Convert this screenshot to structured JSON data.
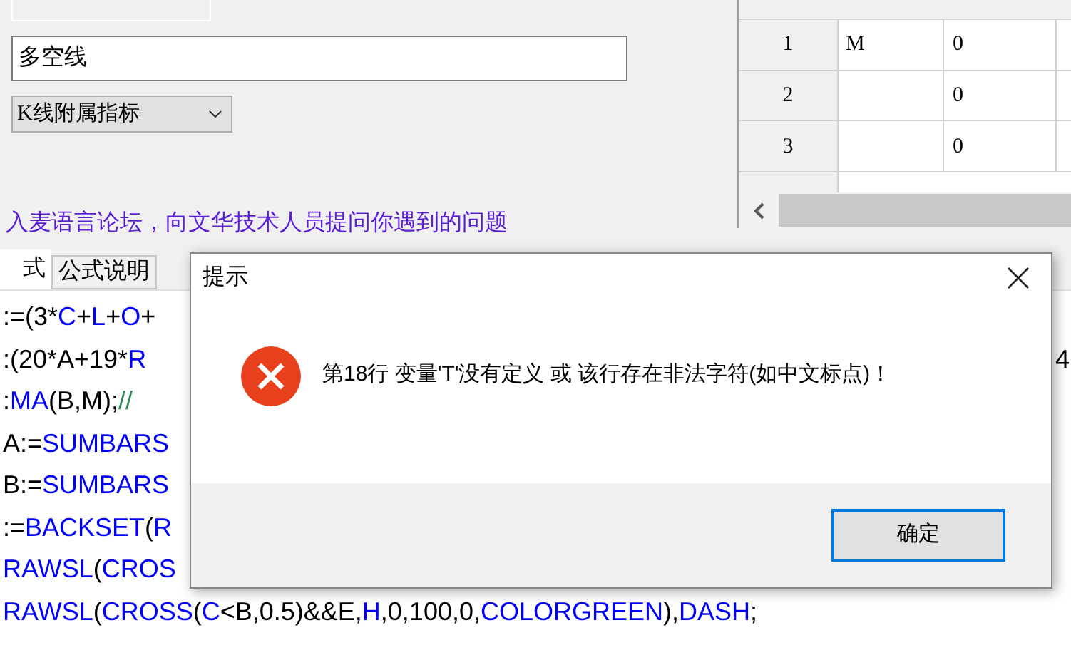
{
  "top_panel": {
    "name_field": {
      "value": "多空线"
    },
    "type_select": {
      "value": "K线附属指标"
    },
    "forum_link": "入麦语言论坛，向文华技术人员提问你遇到的问题"
  },
  "param_table": {
    "rows": [
      {
        "index": "1",
        "column_2": "M",
        "column_3": "0"
      },
      {
        "index": "2",
        "column_2": "",
        "column_3": "0"
      },
      {
        "index": "3",
        "column_2": "",
        "column_3": "0"
      }
    ]
  },
  "tabs": [
    {
      "label": "式",
      "selected": true
    },
    {
      "label": "公式说明",
      "selected": false
    }
  ],
  "editor": {
    "lines": [
      {
        "tokens": [
          {
            "text": ":=(3*",
            "kind": "plain"
          },
          {
            "text": "C",
            "kind": "keyword"
          },
          {
            "text": "+",
            "kind": "plain"
          },
          {
            "text": "L",
            "kind": "keyword"
          },
          {
            "text": "+",
            "kind": "plain"
          },
          {
            "text": "O",
            "kind": "keyword"
          },
          {
            "text": "+",
            "kind": "plain"
          }
        ]
      },
      {
        "tokens": [
          {
            "text": ":(20*A+19*",
            "kind": "plain"
          },
          {
            "text": "R",
            "kind": "keyword"
          }
        ],
        "trailing": "4"
      },
      {
        "tokens": [
          {
            "text": ":",
            "kind": "plain"
          },
          {
            "text": "MA",
            "kind": "keyword"
          },
          {
            "text": "(B,M);",
            "kind": "plain"
          },
          {
            "text": "//",
            "kind": "comment"
          }
        ]
      },
      {
        "tokens": [
          {
            "text": "A:=",
            "kind": "plain"
          },
          {
            "text": "SUMBARS",
            "kind": "keyword"
          }
        ]
      },
      {
        "tokens": [
          {
            "text": "B:=",
            "kind": "plain"
          },
          {
            "text": "SUMBARS",
            "kind": "keyword"
          }
        ]
      },
      {
        "tokens": [
          {
            "text": ":=",
            "kind": "plain"
          },
          {
            "text": "BACKSET",
            "kind": "keyword"
          },
          {
            "text": "(",
            "kind": "plain"
          },
          {
            "text": "R",
            "kind": "keyword"
          }
        ]
      },
      {
        "tokens": [
          {
            "text": "RAWSL",
            "kind": "keyword"
          },
          {
            "text": "(",
            "kind": "plain"
          },
          {
            "text": "CROS",
            "kind": "keyword"
          }
        ]
      },
      {
        "tokens": [
          {
            "text": "RAWSL",
            "kind": "keyword"
          },
          {
            "text": "(",
            "kind": "plain"
          },
          {
            "text": "CROSS",
            "kind": "keyword"
          },
          {
            "text": "(",
            "kind": "plain"
          },
          {
            "text": "C",
            "kind": "keyword"
          },
          {
            "text": "<B,0.5)&&E,",
            "kind": "plain"
          },
          {
            "text": "H",
            "kind": "keyword"
          },
          {
            "text": ",0,100,0,",
            "kind": "plain"
          },
          {
            "text": "COLORGREEN",
            "kind": "keyword"
          },
          {
            "text": "),",
            "kind": "plain"
          },
          {
            "text": "DASH",
            "kind": "keyword"
          },
          {
            "text": ";",
            "kind": "plain"
          }
        ]
      }
    ]
  },
  "dialog": {
    "title": "提示",
    "message": "第18行 变量'T'没有定义 或 该行存在非法字符(如中文标点)！",
    "buttons": [
      {
        "label": "确定",
        "default": true
      }
    ]
  }
}
